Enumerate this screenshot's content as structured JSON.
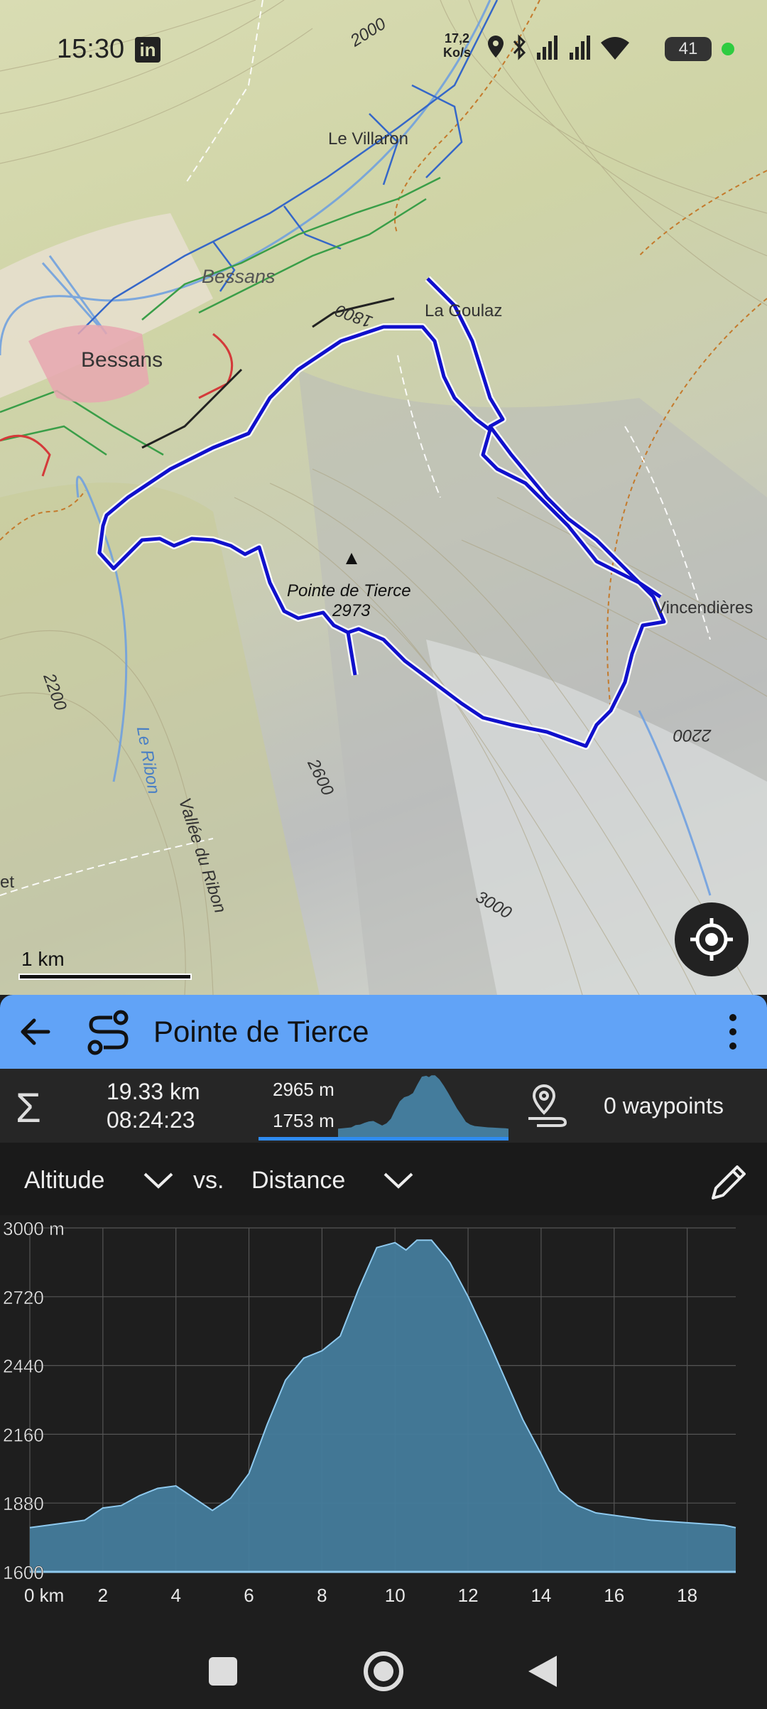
{
  "status_bar": {
    "time": "15:30",
    "app_icon": "linkedin-icon",
    "speed_value": "17,2",
    "speed_unit": "Ko/s",
    "battery": "41"
  },
  "map": {
    "labels": [
      {
        "text": "2000",
        "style": "contour"
      },
      {
        "text": "Le Villaron",
        "style": "place"
      },
      {
        "text": "Bessans",
        "style": "place-italic"
      },
      {
        "text": "1800",
        "style": "contour"
      },
      {
        "text": "La Goulaz",
        "style": "place"
      },
      {
        "text": "Bessans",
        "style": "town"
      },
      {
        "text": "Pointe de Tierce",
        "style": "peak"
      },
      {
        "text": "2973",
        "style": "peak"
      },
      {
        "text": "Vincendières",
        "style": "place"
      },
      {
        "text": "2200",
        "style": "contour"
      },
      {
        "text": "2200",
        "style": "contour"
      },
      {
        "text": "Le Ribon",
        "style": "water"
      },
      {
        "text": "Vallée du Ribon",
        "style": "valley"
      },
      {
        "text": "2600",
        "style": "contour"
      },
      {
        "text": "et",
        "style": "place"
      },
      {
        "text": "3000",
        "style": "contour"
      }
    ],
    "scale_label": "1 km",
    "route_color": "#1010cc",
    "locate_icon": "crosshair-icon"
  },
  "header": {
    "title": "Pointe de Tierce",
    "back_icon": "arrow-left-icon",
    "route_icon": "route-icon",
    "menu_icon": "more-vertical-icon",
    "color": "#61a3f7"
  },
  "stats": {
    "sigma_icon": "sigma-icon",
    "distance": "19.33 km",
    "duration": "08:24:23",
    "elev_max": "2965 m",
    "elev_min": "1753 m",
    "waypoints": "0 waypoints",
    "waypoint_icon": "waypoint-pin-icon"
  },
  "axis_selector": {
    "y_axis": "Altitude",
    "vs": "vs.",
    "x_axis": "Distance",
    "edit_icon": "pencil-icon"
  },
  "chart_data": {
    "type": "area",
    "x": [
      0,
      1,
      1.5,
      2,
      2.5,
      3,
      3.5,
      4,
      4.5,
      5,
      5.5,
      6,
      6.5,
      7,
      7.5,
      8,
      8.5,
      9,
      9.5,
      10,
      10.3,
      10.6,
      11,
      11.5,
      12,
      12.5,
      13,
      13.5,
      14,
      14.5,
      15,
      15.5,
      16,
      16.5,
      17,
      17.5,
      18,
      18.5,
      19,
      19.33
    ],
    "y": [
      1780,
      1800,
      1810,
      1860,
      1870,
      1910,
      1940,
      1950,
      1900,
      1850,
      1900,
      2000,
      2200,
      2380,
      2470,
      2500,
      2560,
      2750,
      2920,
      2940,
      2910,
      2950,
      2950,
      2860,
      2720,
      2560,
      2390,
      2220,
      2080,
      1930,
      1870,
      1840,
      1830,
      1820,
      1810,
      1805,
      1800,
      1795,
      1790,
      1780
    ],
    "xlabel": "",
    "ylabel": "",
    "xlim": [
      0,
      19.33
    ],
    "ylim": [
      1600,
      3000
    ],
    "x_ticks": [
      "0 km",
      "2",
      "4",
      "6",
      "8",
      "10",
      "12",
      "14",
      "16",
      "18"
    ],
    "y_ticks": [
      "3000 m",
      "2720",
      "2440",
      "2160",
      "1880",
      "1600"
    ],
    "grid": true,
    "fill_color": "#447c9c",
    "line_color": "#8ec9ee"
  },
  "nav": {
    "recents_icon": "square-icon",
    "home_icon": "circle-icon",
    "back_icon": "triangle-back-icon"
  }
}
